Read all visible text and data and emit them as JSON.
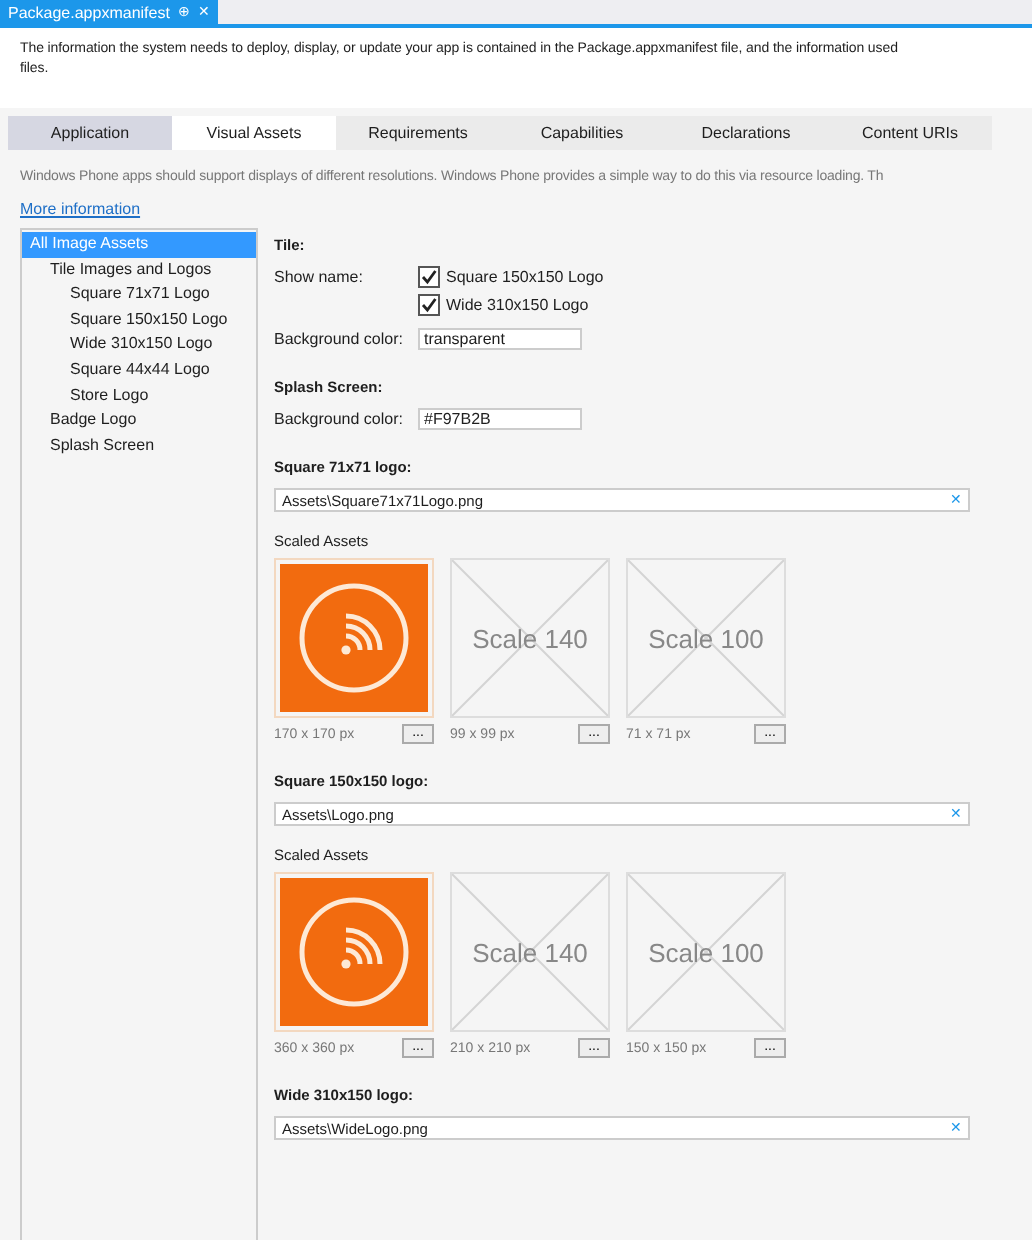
{
  "document_tab": {
    "title": "Package.appxmanifest",
    "pin": "⊕",
    "close": "✕"
  },
  "description": [
    "The information the system needs to deploy, display, or update your app is contained in the Package.appxmanifest file, and the information used",
    "files."
  ],
  "tabs": [
    {
      "label": "Application",
      "selected": false,
      "hovered": true
    },
    {
      "label": "Visual Assets",
      "selected": true,
      "hovered": false
    },
    {
      "label": "Requirements",
      "selected": false,
      "hovered": false
    },
    {
      "label": "Capabilities",
      "selected": false,
      "hovered": false
    },
    {
      "label": "Declarations",
      "selected": false,
      "hovered": false
    },
    {
      "label": "Content URIs",
      "selected": false,
      "hovered": false
    }
  ],
  "hint": "Windows Phone apps should support displays of different resolutions. Windows Phone provides a simple way to do this via resource loading. Th",
  "more_link": "More information",
  "sidebar": {
    "items": [
      {
        "label": "All Image Assets",
        "selected": true,
        "children": [
          {
            "label": "Tile Images and Logos",
            "selected": false,
            "children": [
              {
                "label": "Square 71x71 Logo",
                "selected": false
              },
              {
                "label": "Square 150x150 Logo",
                "selected": false
              },
              {
                "label": "Wide 310x150 Logo",
                "selected": false
              },
              {
                "label": "Square 44x44 Logo",
                "selected": false
              },
              {
                "label": "Store Logo",
                "selected": false
              }
            ]
          },
          {
            "label": "Badge Logo",
            "selected": false
          },
          {
            "label": "Splash Screen",
            "selected": false
          }
        ]
      }
    ]
  },
  "tile": {
    "heading": "Tile:",
    "show_name_label": "Show name:",
    "show_name": [
      {
        "label": "Square 150x150 Logo",
        "checked": true
      },
      {
        "label": "Wide 310x150 Logo",
        "checked": true
      }
    ],
    "background_label": "Background color:",
    "background_value": "transparent"
  },
  "splash": {
    "heading": "Splash Screen:",
    "background_label": "Background color:",
    "background_value": "#F97B2B"
  },
  "logos": [
    {
      "heading": "Square 71x71 logo:",
      "path": "Assets\\Square71x71Logo.png",
      "clear": "✕",
      "scaled_label": "Scaled Assets",
      "assets": [
        {
          "kind": "image",
          "size": "170 x 170 px",
          "browse": "..."
        },
        {
          "kind": "placeholder",
          "text": "Scale 140",
          "size": "99 x 99 px",
          "browse": "..."
        },
        {
          "kind": "placeholder",
          "text": "Scale 100",
          "size": "71 x 71 px",
          "browse": "..."
        }
      ]
    },
    {
      "heading": "Square 150x150 logo:",
      "path": "Assets\\Logo.png",
      "clear": "✕",
      "scaled_label": "Scaled Assets",
      "assets": [
        {
          "kind": "image",
          "size": "360 x 360 px",
          "browse": "..."
        },
        {
          "kind": "placeholder",
          "text": "Scale 140",
          "size": "210 x 210 px",
          "browse": "..."
        },
        {
          "kind": "placeholder",
          "text": "Scale 100",
          "size": "150 x 150 px",
          "browse": "..."
        }
      ]
    },
    {
      "heading": "Wide 310x150 logo:",
      "path": "Assets\\WideLogo.png",
      "clear": "✕"
    }
  ]
}
